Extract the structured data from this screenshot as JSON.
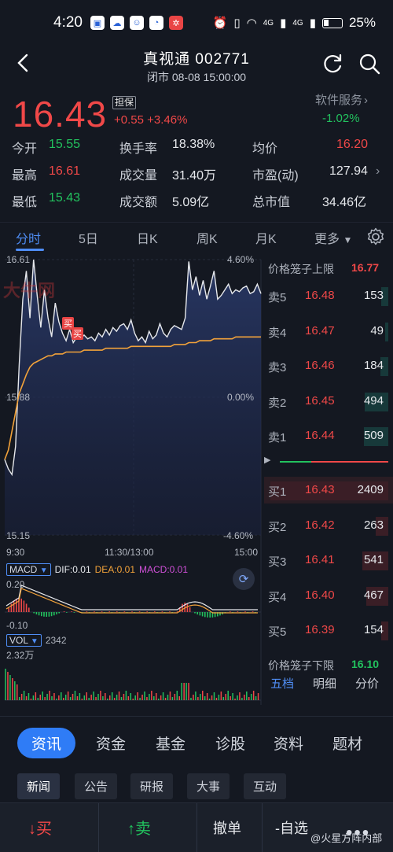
{
  "status": {
    "time": "4:20",
    "signal": "4G",
    "signal2": "4G",
    "battery": "25%"
  },
  "header": {
    "title": "真视通 002771",
    "subtitle": "闭市 08-08 15:00:00"
  },
  "quote": {
    "price": "16.43",
    "badge": "担保",
    "change": "+0.55 +3.46%",
    "service_label": "软件服务",
    "service_change": "-1.02%",
    "open_label": "今开",
    "open": "15.55",
    "turnover_rate_label": "换手率",
    "turnover_rate": "18.38%",
    "avg_label": "均价",
    "avg": "16.20",
    "high_label": "最高",
    "high": "16.61",
    "volume_label": "成交量",
    "volume": "31.40万",
    "pe_label": "市盈(动)",
    "pe": "127.94",
    "low_label": "最低",
    "low": "15.43",
    "amount_label": "成交额",
    "amount": "5.09亿",
    "mktcap_label": "总市值",
    "mktcap": "34.46亿"
  },
  "tabs": [
    "分时",
    "5日",
    "日K",
    "周K",
    "月K",
    "更多"
  ],
  "chart_data": {
    "type": "line",
    "price_axis": {
      "top": "16.61",
      "mid": "15.88",
      "bottom": "15.15"
    },
    "pct_axis": {
      "top": "4.60%",
      "mid": "0.00%",
      "bottom": "-4.60%"
    },
    "time_axis": [
      "9:30",
      "11:30/13:00",
      "15:00"
    ],
    "ylim": [
      15.15,
      16.61
    ],
    "price": [
      15.55,
      15.5,
      15.47,
      15.62,
      16.05,
      16.4,
      16.55,
      16.3,
      16.61,
      16.42,
      16.25,
      16.45,
      16.3,
      16.2,
      16.38,
      16.28,
      16.22,
      16.18,
      16.24,
      16.17,
      16.2,
      16.19,
      16.21,
      16.19,
      16.2,
      16.18,
      16.22,
      16.2,
      16.24,
      16.21,
      16.25,
      16.23,
      16.26,
      16.27,
      16.24,
      16.29,
      16.22,
      16.18,
      16.2,
      16.17,
      16.23,
      16.19,
      16.21,
      16.27,
      16.22,
      16.2,
      16.24,
      16.26,
      16.25,
      16.24,
      16.3,
      16.6,
      16.45,
      16.52,
      16.42,
      16.5,
      16.4,
      16.47,
      16.55,
      16.4,
      16.42,
      16.45,
      16.48,
      16.43,
      16.45,
      16.44,
      16.46,
      16.47,
      16.43,
      16.44,
      16.48,
      16.43
    ],
    "avg": [
      15.55,
      15.6,
      15.7,
      15.8,
      15.9,
      15.95,
      16.0,
      16.04,
      16.06,
      16.07,
      16.08,
      16.09,
      16.1,
      16.1,
      16.11,
      16.11,
      16.11,
      16.12,
      16.12,
      16.12,
      16.12,
      16.12,
      16.13,
      16.13,
      16.13,
      16.13,
      16.13,
      16.13,
      16.14,
      16.14,
      16.14,
      16.14,
      16.14,
      16.14,
      16.14,
      16.15,
      16.15,
      16.15,
      16.15,
      16.15,
      16.15,
      16.15,
      16.15,
      16.15,
      16.15,
      16.15,
      16.15,
      16.16,
      16.16,
      16.16,
      16.16,
      16.17,
      16.17,
      16.17,
      16.18,
      16.18,
      16.18,
      16.18,
      16.19,
      16.19,
      16.19,
      16.19,
      16.19,
      16.19,
      16.2,
      16.2,
      16.2,
      16.2,
      16.2,
      16.2,
      16.2,
      16.2
    ],
    "markers": [
      "买",
      "买"
    ],
    "macd": {
      "label": "MACD",
      "dif_label": "DIF:0.01",
      "dea_label": "DEA:0.01",
      "macd_label": "MACD:0.01",
      "top": "0.20",
      "bottom": "-0.10"
    },
    "vol": {
      "label": "VOL",
      "value": "2342",
      "top": "2.32万"
    }
  },
  "watermark_top": "大牛网",
  "order_book": {
    "upper_limit_label": "价格笼子上限",
    "upper_limit": "16.77",
    "asks": [
      {
        "label": "卖5",
        "price": "16.48",
        "vol": "153",
        "ratio": 0.06
      },
      {
        "label": "卖4",
        "price": "16.47",
        "vol": "49",
        "ratio": 0.02
      },
      {
        "label": "卖3",
        "price": "16.46",
        "vol": "184",
        "ratio": 0.07
      },
      {
        "label": "卖2",
        "price": "16.45",
        "vol": "494",
        "ratio": 0.2
      },
      {
        "label": "卖1",
        "price": "16.44",
        "vol": "509",
        "ratio": 0.21
      }
    ],
    "bids": [
      {
        "label": "买1",
        "price": "16.43",
        "vol": "2409",
        "ratio": 1.0
      },
      {
        "label": "买2",
        "price": "16.42",
        "vol": "263",
        "ratio": 0.11
      },
      {
        "label": "买3",
        "price": "16.41",
        "vol": "541",
        "ratio": 0.22
      },
      {
        "label": "买4",
        "price": "16.40",
        "vol": "467",
        "ratio": 0.19
      },
      {
        "label": "买5",
        "price": "16.39",
        "vol": "154",
        "ratio": 0.06
      }
    ],
    "lower_limit_label": "价格笼子下限",
    "lower_limit": "16.10",
    "tabs": [
      "五档",
      "明细",
      "分价"
    ]
  },
  "news": {
    "tabs": [
      "资讯",
      "资金",
      "基金",
      "诊股",
      "资料",
      "题材"
    ],
    "subtabs": [
      "新闻",
      "公告",
      "研报",
      "大事",
      "互动"
    ]
  },
  "actions": {
    "buy": "买",
    "sell": "卖",
    "cancel": "撤单",
    "watch": "-自选",
    "watermark": "@火星方阵内部"
  },
  "colors": {
    "up": "#f04848",
    "down": "#22c25e",
    "accent": "#4f8df5",
    "avg": "#f2a23a"
  }
}
